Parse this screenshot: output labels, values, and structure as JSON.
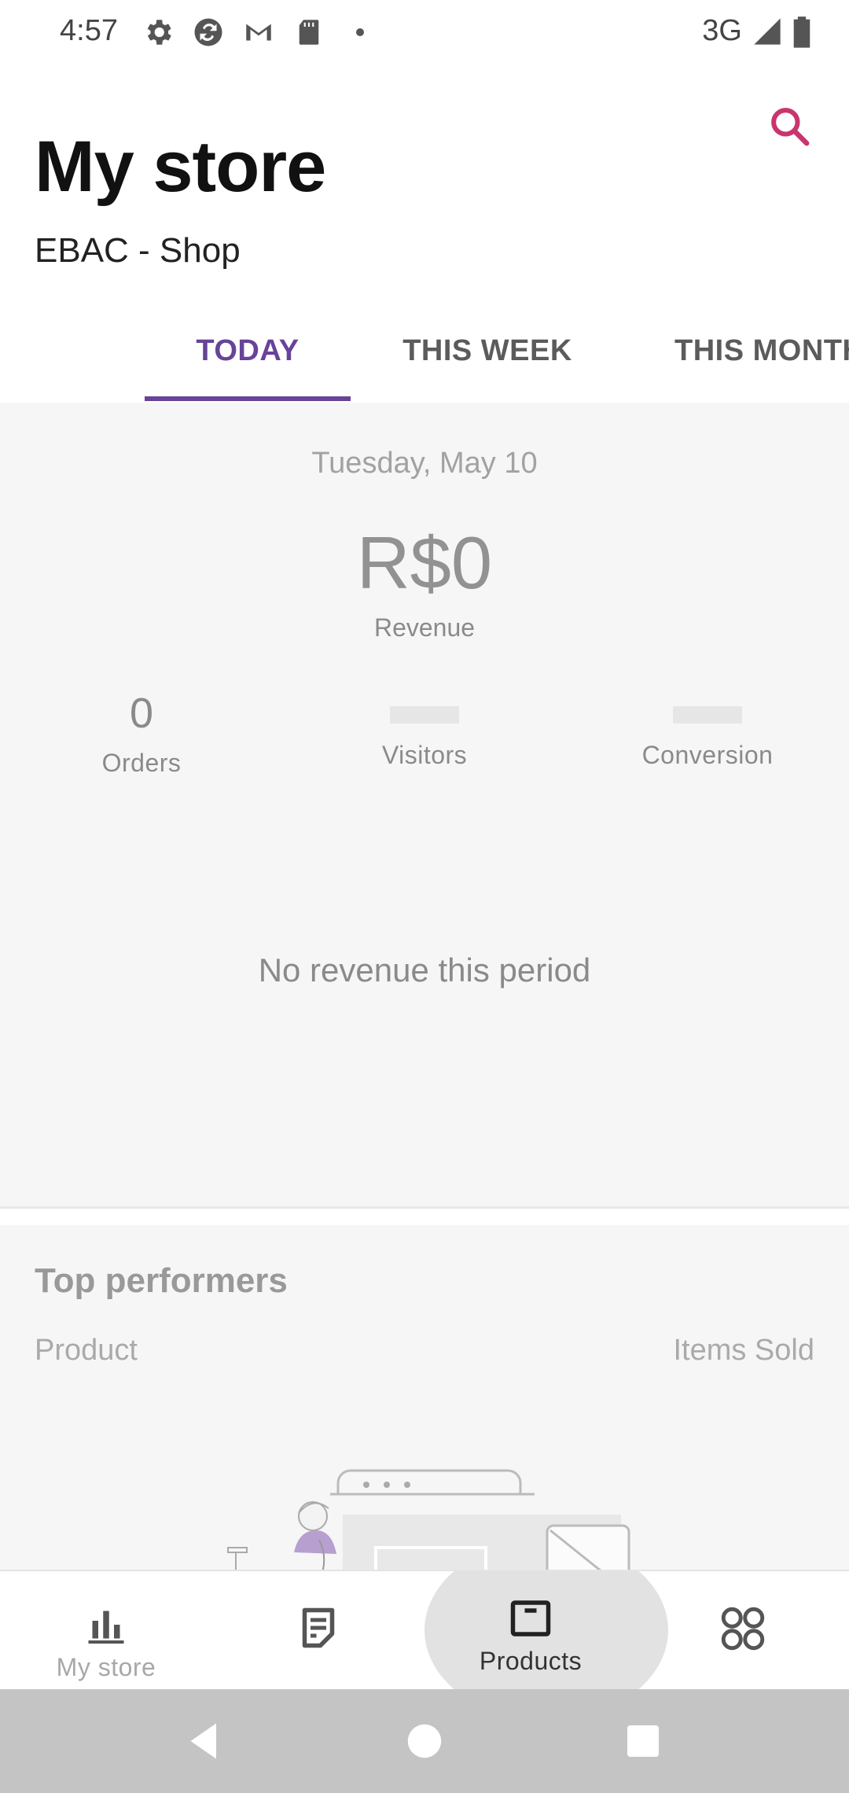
{
  "status_bar": {
    "time": "4:57",
    "network": "3G",
    "icons": [
      "gear-icon",
      "sync-icon",
      "gmail-icon",
      "sd-card-icon",
      "dot-icon"
    ]
  },
  "header": {
    "title": "My store",
    "store_name": "EBAC - Shop",
    "search_icon": "search-icon"
  },
  "tabs": [
    {
      "label": "TODAY",
      "active": true
    },
    {
      "label": "THIS WEEK",
      "active": false
    },
    {
      "label": "THIS MONTH",
      "active": false
    }
  ],
  "stats": {
    "date": "Tuesday, May 10",
    "revenue_value": "R$0",
    "revenue_label": "Revenue",
    "orders_value": "0",
    "orders_label": "Orders",
    "visitors_label": "Visitors",
    "conversion_label": "Conversion",
    "empty_message": "No revenue this period"
  },
  "top_performers": {
    "title": "Top performers",
    "col_product": "Product",
    "col_items": "Items Sold"
  },
  "bottom_nav": [
    {
      "label": "My store",
      "icon": "bar-chart-icon"
    },
    {
      "label": "",
      "icon": "orders-icon"
    },
    {
      "label": "Products",
      "icon": "product-box-icon"
    },
    {
      "label": "",
      "icon": "more-grid-icon"
    }
  ],
  "colors": {
    "accent": "#674399",
    "search": "#c9356e",
    "card_bg": "#f6f6f6",
    "system_nav": "#c4c4c4"
  }
}
